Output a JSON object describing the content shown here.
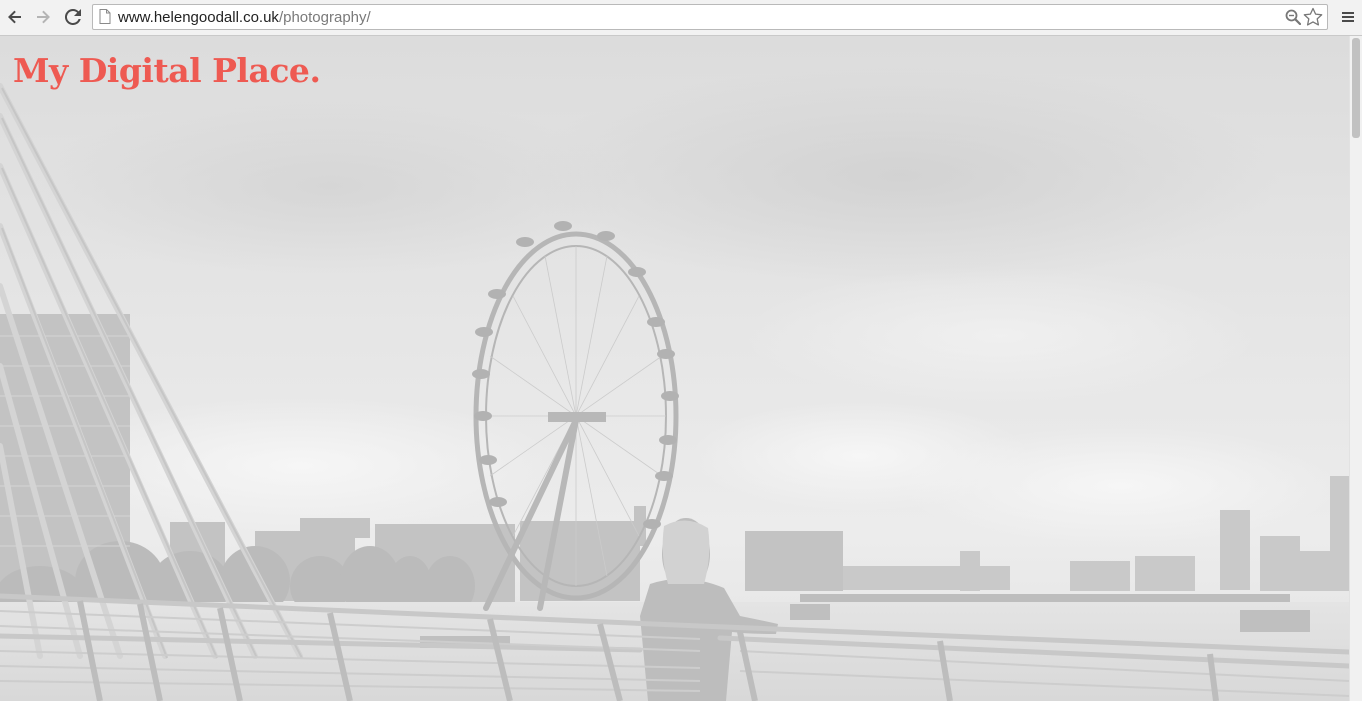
{
  "browser": {
    "url_host": "www.helengoodall.co.uk",
    "url_path": "/photography/",
    "icons": {
      "back": "arrow-left-icon",
      "forward": "arrow-right-icon",
      "reload": "reload-icon",
      "page": "page-icon",
      "zoom": "magnifier-icon",
      "bookmark": "star-icon",
      "menu": "hamburger-menu-icon"
    }
  },
  "page": {
    "site_title": "My Digital Place",
    "site_title_dot": ".",
    "brand_color": "#ee5a52",
    "hero_image": "Faded greyscale photograph of the London Eye and the River Thames seen from a footbridge, a woman leaning on the railing"
  }
}
